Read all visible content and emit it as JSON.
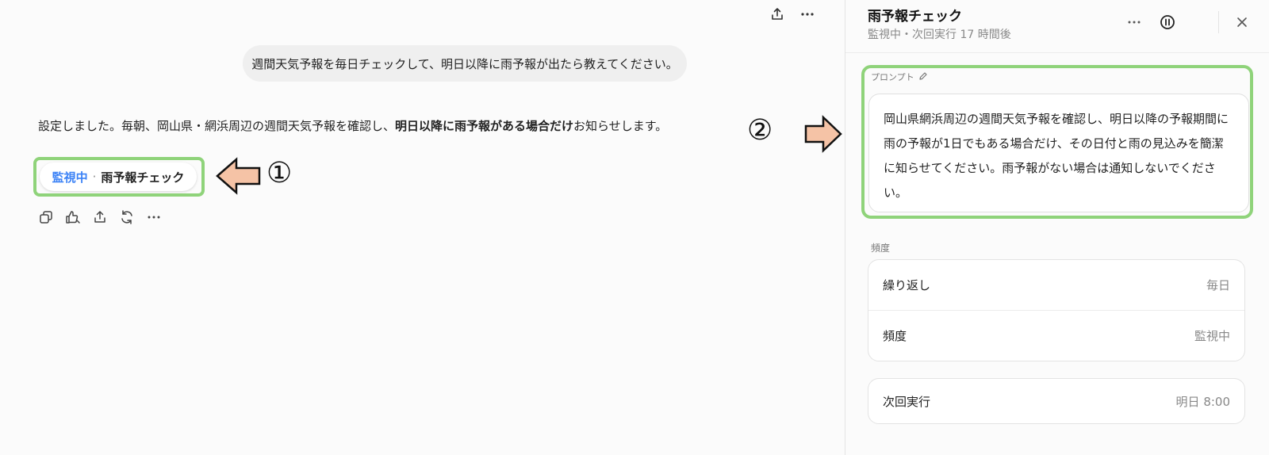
{
  "chat": {
    "toolbar": {
      "share_icon": "share-icon",
      "more_icon": "more-icon"
    },
    "user_message": "週間天気予報を毎日チェックして、明日以降に雨予報が出たら教えてください。",
    "assistant": {
      "text_before": "設定しました。毎朝、岡山県・網浜周辺の週間天気予報を確認し、",
      "text_bold": "明日以降に雨予報がある場合だけ",
      "text_after": "お知らせします。"
    },
    "task_chip": {
      "status": "監視中",
      "separator": "·",
      "name": "雨予報チェック"
    },
    "annotation_1": "①",
    "action_icons": [
      "copy-icon",
      "feedback-icon",
      "share-icon",
      "regenerate-icon",
      "more-icon"
    ]
  },
  "panel": {
    "title": "雨予報チェック",
    "subtitle": "監視中・次回実行 17 時間後",
    "annotation_2": "②",
    "prompt": {
      "label": "プロンプト",
      "text": "岡山県網浜周辺の週間天気予報を確認し、明日以降の予報期間に雨の予報が1日でもある場合だけ、その日付と雨の見込みを簡潔に知らせてください。雨予報がない場合は通知しないでください。"
    },
    "frequency": {
      "label": "頻度",
      "rows": [
        {
          "key": "繰り返し",
          "value": "毎日"
        },
        {
          "key": "頻度",
          "value": "監視中"
        }
      ]
    },
    "next_run": {
      "key": "次回実行",
      "value": "明日 8:00"
    }
  },
  "colors": {
    "accent": "#3b82f6",
    "highlight": "#8fd37a",
    "arrow_fill": "#f5c3a6"
  }
}
